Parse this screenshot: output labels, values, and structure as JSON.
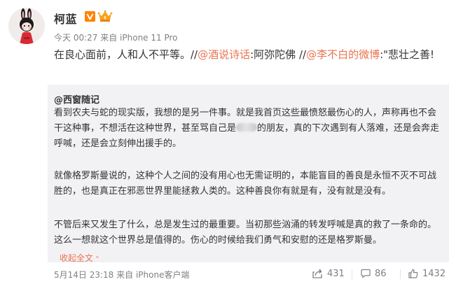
{
  "author": {
    "name": "柯蓝",
    "verified_color": "#ff8200",
    "vip_color": "#f9a11b"
  },
  "post": {
    "time": "今天 00:27",
    "source": "来自 iPhone 11 Pro",
    "text_segments": [
      {
        "text": "在良心面前，人和人不平等。//",
        "link": false
      },
      {
        "text": "@酒说诗话",
        "link": true
      },
      {
        "text": ":阿弥陀佛 //",
        "link": false
      },
      {
        "text": "@李不白的微博",
        "link": true
      },
      {
        "text": ":\"悲壮之善!",
        "link": false
      }
    ]
  },
  "repost": {
    "author": "@西窗随记",
    "p1_a": "看到农夫与蛇的现实版，我想的是另一件事。就是我首页这些最愤怒最伤心的人，声称再也不会干这种事，不想活在这种世界，甚至骂自己是",
    "p1_b": "的朋友，真的下次遇到有人落难，还是会奔走呼喊，还是会立刻伸出援手的。",
    "p2": "就像格罗斯曼说的，这种个人之间的没有用心也无需证明的，本能盲目的善良是永恒不灭不可战胜的，也是真正在邪恶世界里能拯救人类的。这种善良你有就是有，没有就是没有。",
    "p3": "不管后来又发生了什么，总是发生过的最重要。当初那些汹涌的转发呼喊是真的救了一条命的。这么一想就这个世界总是值得的。伤心的时候给我们勇气和安慰的还是格罗斯曼。",
    "collapse_label": "收起全文",
    "collapse_icon": "chevron-up-icon",
    "time": "5月14日 23:18",
    "source": "来自 iPhone客户端"
  },
  "actions": {
    "forward_count": "431",
    "comment_count": "86",
    "like_count": "1432"
  },
  "colors": {
    "accent": "#eb7350",
    "repost_bg": "#f2f2f5",
    "meta_text": "#808080"
  }
}
